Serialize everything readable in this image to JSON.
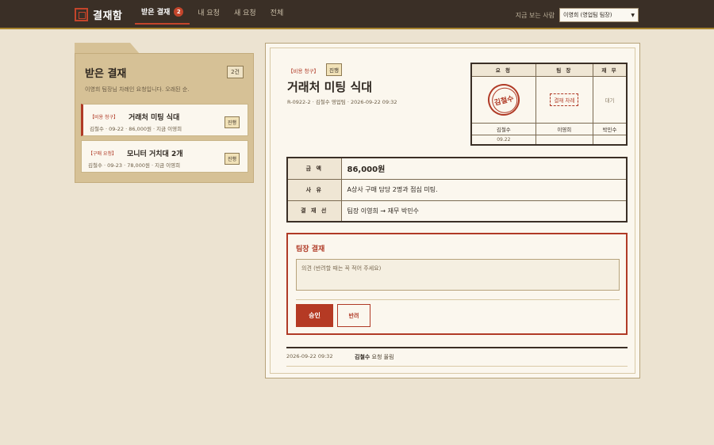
{
  "app": {
    "logo_text": "결재함",
    "nav": [
      {
        "label": "받은 결재",
        "badge": "2",
        "active": true
      },
      {
        "label": "내 요청"
      },
      {
        "label": "새 요청"
      },
      {
        "label": "전체"
      }
    ],
    "viewer_label": "지금 보는 사람",
    "viewer_selected": "이영희 (영업팀 팀장)"
  },
  "inbox": {
    "title": "받은 결재",
    "count": "2건",
    "description": "이영희 팀장님 차례인 요청입니다. 오래된 순.",
    "items": [
      {
        "category": "【비용 청구】",
        "title": "거래처 미팅 식대",
        "meta": "김철수 · 09-22 · 86,000원 · 지금 이영희",
        "status": "진행"
      },
      {
        "category": "【구매 요청】",
        "title": "모니터 거치대 2개",
        "meta": "김철수 · 09-23 · 78,000원 · 지금 이영희",
        "status": "진행"
      }
    ]
  },
  "document": {
    "category": "【비용 청구】",
    "status": "진행",
    "title": "거래처 미팅 식대",
    "meta": "R-0922-2 · 김철수 영업팀 · 2026-09-22 09:32",
    "approval": {
      "headers": [
        "요 청",
        "팀 장",
        "재 무"
      ],
      "seal_name": "김철수",
      "sign_button": "결재 차례",
      "waiting": "대기",
      "names": [
        "김철수",
        "이영희",
        "박민수"
      ],
      "dates": [
        "09.22",
        "",
        ""
      ]
    },
    "info": [
      {
        "label": "금 액",
        "value": "86,000원"
      },
      {
        "label": "사 유",
        "value": "A상사 구매 담당 2명과 점심 미팅."
      },
      {
        "label": "결 재 선",
        "value": "팀장 이영희 → 재무 박민수"
      }
    ],
    "approve_box": {
      "title": "팀장 결재",
      "placeholder": "의견 (반려할 때는 꼭 적어 주세요)",
      "approve_label": "승인",
      "reject_label": "반려"
    },
    "log": {
      "time": "2026-09-22 09:32",
      "actor": "김철수",
      "action": " 요청 올림"
    }
  }
}
